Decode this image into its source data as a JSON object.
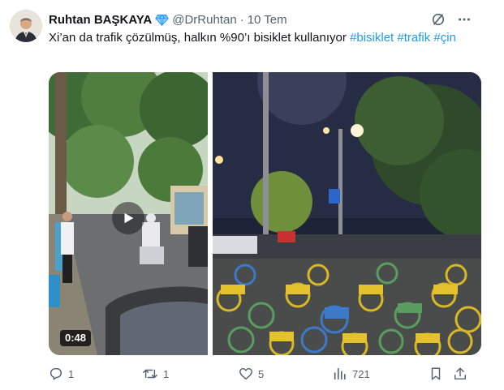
{
  "author": {
    "display_name": "Ruhtan BAŞKAYA",
    "handle": "@DrRuhtan",
    "separator": "·",
    "date": "10 Tem"
  },
  "tweet": {
    "text": "Xi’an da trafik çözülmüş, halkın %90’ı bisiklet kullanıyor",
    "hashtags": [
      "#bisiklet",
      "#trafik",
      "#çin"
    ]
  },
  "media": {
    "video_duration": "0:48"
  },
  "icons": {
    "verified": "verified-badge-icon",
    "grok": "grok-icon",
    "more": "more-icon",
    "play": "play-icon",
    "next": "arrow-right-icon",
    "reply": "reply-icon",
    "retweet": "retweet-icon",
    "like": "heart-icon",
    "views": "views-icon",
    "bookmark": "bookmark-icon",
    "share": "share-icon"
  },
  "actions": {
    "replies": "1",
    "retweets": "1",
    "likes": "5",
    "views": "721"
  },
  "colors": {
    "accent": "#1d9bf0",
    "text": "#0f1419",
    "secondary": "#536471"
  }
}
